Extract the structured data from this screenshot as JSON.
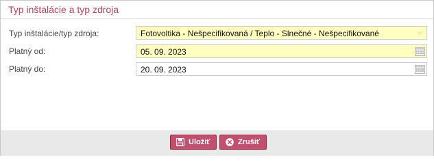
{
  "dialog": {
    "title": "Typ inštalácie a typ zdroja"
  },
  "form": {
    "type": {
      "label": "Typ inštalácie/typ zdroja:",
      "value": "Fotovoltika - Nešpecifikovaná / Teplo - Slnečné - Nešpecifikované",
      "icon": "chevron-down-icon"
    },
    "valid_from": {
      "label": "Platný od:",
      "value": "05. 09. 2023",
      "icon": "calendar-icon"
    },
    "valid_to": {
      "label": "Platný do:",
      "value": "20. 09. 2023",
      "icon": "calendar-icon"
    }
  },
  "footer": {
    "save_label": "Uložiť",
    "save_icon": "save-icon",
    "cancel_label": "Zrušiť",
    "cancel_icon": "close-circle-icon"
  },
  "colors": {
    "accent": "#c0506d",
    "title": "#b8425e",
    "highlight_field": "#ffffc0",
    "footer_bg": "#e9e9e9"
  }
}
